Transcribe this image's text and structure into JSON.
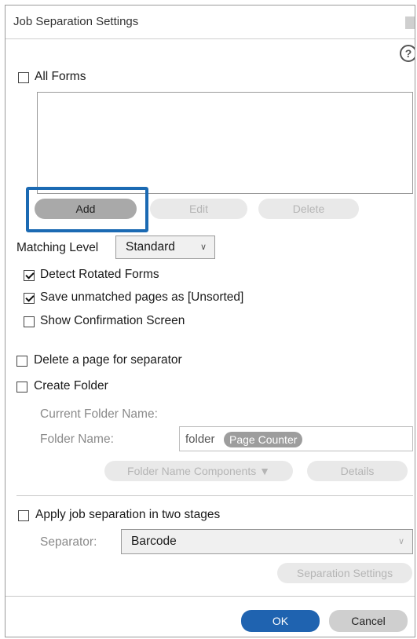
{
  "window": {
    "title": "Job Separation Settings"
  },
  "help_icon": {
    "glyph": "?"
  },
  "forms": {
    "all_forms_label": "All Forms",
    "all_forms_checked": false,
    "list_items": []
  },
  "buttons": {
    "add": "Add",
    "edit": "Edit",
    "delete": "Delete"
  },
  "matching": {
    "label": "Matching Level",
    "value": "Standard"
  },
  "options": {
    "detect_rotated": "Detect Rotated Forms",
    "save_unmatched": "Save unmatched pages as [Unsorted]",
    "show_confirmation": "Show Confirmation Screen",
    "delete_page": "Delete a page for separator",
    "create_folder": "Create Folder"
  },
  "folder": {
    "current_label": "Current Folder Name:",
    "name_label": "Folder Name:",
    "name_prefix": "folder",
    "token": "Page Counter",
    "components_button": "Folder Name Components ▼",
    "details_button": "Details"
  },
  "two_stage": {
    "label": "Apply job separation in two stages",
    "separator_label": "Separator:",
    "separator_value": "Barcode",
    "settings_button": "Separation Settings"
  },
  "footer": {
    "ok": "OK",
    "cancel": "Cancel"
  },
  "colors": {
    "accent": "#1f63b0",
    "highlight": "#1b6ab3"
  }
}
